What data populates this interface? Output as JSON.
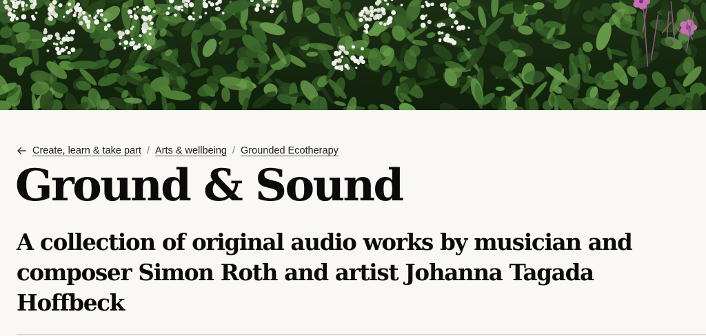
{
  "hero": {
    "image_description": "dense green foliage with white cow parsley flowers and pink geranium blooms",
    "icon": "hero-foliage-image"
  },
  "breadcrumb": {
    "back_icon": "arrow-left-icon",
    "items": [
      {
        "label": "Create, learn & take part"
      },
      {
        "label": "Arts & wellbeing"
      },
      {
        "label": "Grounded Ecotherapy"
      }
    ],
    "separator": "/"
  },
  "page": {
    "title": "Ground & Sound",
    "subtitle": "A collection of original audio works by musician and composer Simon Roth and artist Johanna Tagada Hoffbeck"
  },
  "colors": {
    "background": "#faf8f4",
    "text": "#0b0b0b",
    "divider": "#cfcac2"
  }
}
